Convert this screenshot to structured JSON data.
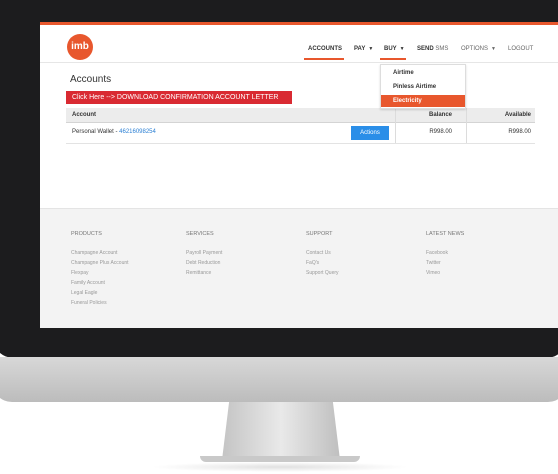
{
  "logo": {
    "text": "imb"
  },
  "nav": {
    "accounts": "ACCOUNTS",
    "pay": "PAY",
    "buy": "BUY",
    "send": "SEND",
    "sms": "SMS",
    "options": "OPTIONS",
    "logout": "LOGOUT"
  },
  "buy_menu": {
    "items": [
      "Airtime",
      "Pinless Airtime",
      "Electricity"
    ],
    "active_index": 2
  },
  "page": {
    "title": "Accounts",
    "download_button": "Click Here --> DOWNLOAD CONFIRMATION ACCOUNT LETTER"
  },
  "table": {
    "headers": {
      "account": "Account",
      "balance": "Balance",
      "available": "Available"
    },
    "rows": [
      {
        "name": "Personal Wallet - ",
        "number": "46216098254",
        "actions": "Actions",
        "balance": "R998.00",
        "available": "R998.00"
      }
    ]
  },
  "footer": {
    "products": {
      "title": "PRODUCTS",
      "items": [
        "Champagne Account",
        "Champagne Plus Account",
        "Flexpay",
        "Family Account",
        "Legal Eagle",
        "Funeral Policies"
      ]
    },
    "services": {
      "title": "SERVICES",
      "items": [
        "Payroll Payment",
        "Debt Reduction",
        "Remittance"
      ]
    },
    "support": {
      "title": "SUPPORT",
      "items": [
        "Contact Us",
        "FaQ's",
        "Support Query"
      ]
    },
    "news": {
      "title": "LATEST NEWS",
      "items": [
        "Facebook",
        "Twitter",
        "Vimeo"
      ]
    }
  },
  "colors": {
    "accent": "#e8572d",
    "danger": "#d92a32",
    "primary": "#2a8ee8",
    "link": "#2a7fd4"
  }
}
